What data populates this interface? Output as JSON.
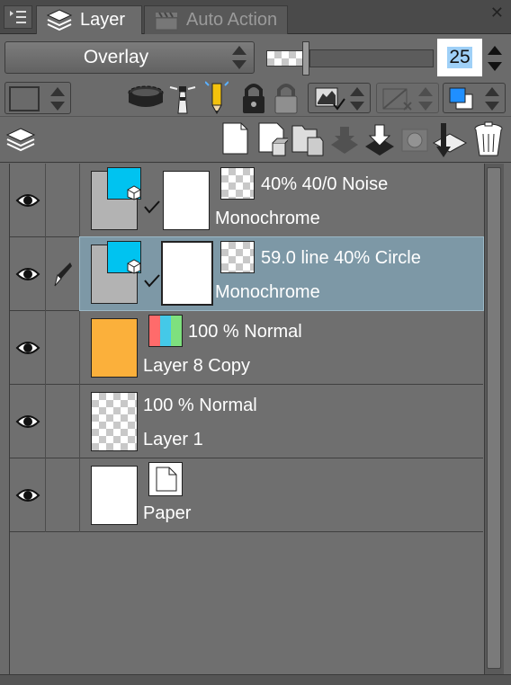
{
  "tabs": [
    {
      "label": "Layer",
      "active": true
    },
    {
      "label": "Auto Action",
      "active": false
    }
  ],
  "blend_mode": {
    "value": "Overlay"
  },
  "opacity": {
    "value": "25",
    "percent": 25
  },
  "layers": [
    {
      "info": "40% 40/0 Noise",
      "name": "Monochrome",
      "selected": false,
      "editing": false
    },
    {
      "info": "59.0 line 40% Circle",
      "name": "Monochrome",
      "selected": true,
      "editing": true
    },
    {
      "info": "100 % Normal",
      "name": "Layer 8 Copy",
      "selected": false,
      "editing": false
    },
    {
      "info": "100 % Normal",
      "name": "Layer 1",
      "selected": false,
      "editing": false
    },
    {
      "info": "",
      "name": "Paper",
      "selected": false,
      "editing": false
    }
  ],
  "colors": {
    "selected_row": "#7d98a6",
    "layer8_fill": "#fbb03b",
    "mask_cyan": "#00c3f0",
    "opacity_highlight": "#9fd0f7"
  }
}
